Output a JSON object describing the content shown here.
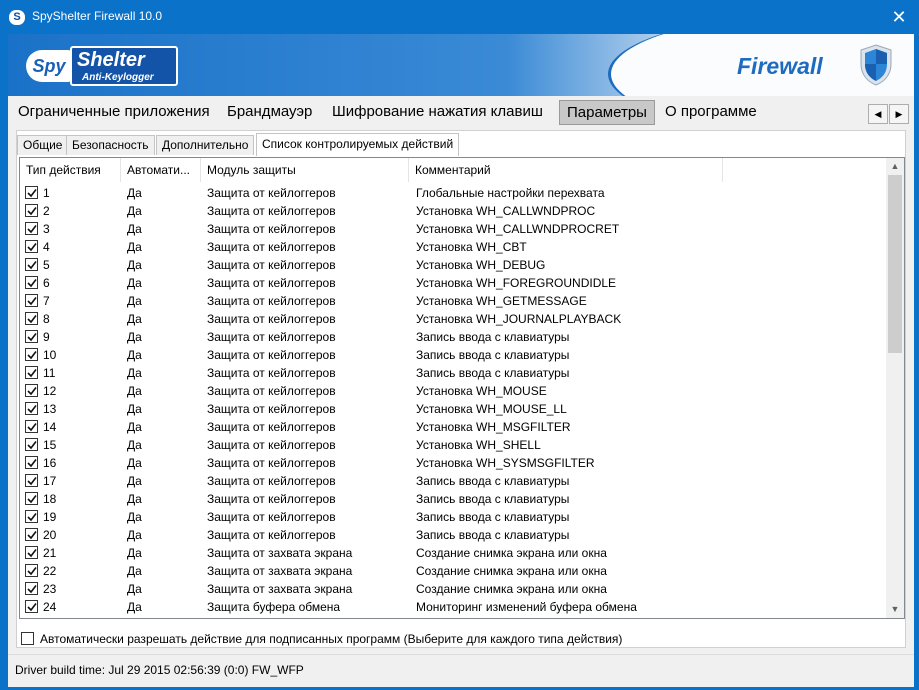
{
  "window": {
    "title": "SpyShelter Firewall 10.0",
    "close_glyph": "✕",
    "app_icon_letter": "S"
  },
  "banner": {
    "logo_spy": "Spy",
    "logo_shelter": "Shelter",
    "logo_sub": "Anti-Keylogger",
    "product": "Firewall"
  },
  "menu": {
    "items": [
      {
        "label": "Ограниченные приложения"
      },
      {
        "label": "Брандмауэр"
      },
      {
        "label": "Шифрование нажатия клавиш"
      },
      {
        "label": "Параметры",
        "active": true
      },
      {
        "label": "О программе"
      }
    ],
    "prev_glyph": "◀",
    "next_glyph": "▶"
  },
  "tabs": [
    {
      "label": "Общие"
    },
    {
      "label": "Безопасность"
    },
    {
      "label": "Дополнительно"
    },
    {
      "label": "Список контролируемых действий",
      "active": true
    }
  ],
  "table": {
    "columns": [
      "Тип действия",
      "Автомати...",
      "Модуль защиты",
      "Комментарий"
    ],
    "rows": [
      {
        "checked": true,
        "type": "1",
        "auto": "Да",
        "module": "Защита от кейлоггеров",
        "comment": "Глобальные настройки перехвата"
      },
      {
        "checked": true,
        "type": "2",
        "auto": "Да",
        "module": "Защита от кейлоггеров",
        "comment": "Установка WH_CALLWNDPROC"
      },
      {
        "checked": true,
        "type": "3",
        "auto": "Да",
        "module": "Защита от кейлоггеров",
        "comment": "Установка WH_CALLWNDPROCRET"
      },
      {
        "checked": true,
        "type": "4",
        "auto": "Да",
        "module": "Защита от кейлоггеров",
        "comment": "Установка WH_CBT"
      },
      {
        "checked": true,
        "type": "5",
        "auto": "Да",
        "module": "Защита от кейлоггеров",
        "comment": "Установка WH_DEBUG"
      },
      {
        "checked": true,
        "type": "6",
        "auto": "Да",
        "module": "Защита от кейлоггеров",
        "comment": "Установка WH_FOREGROUNDIDLE"
      },
      {
        "checked": true,
        "type": "7",
        "auto": "Да",
        "module": "Защита от кейлоггеров",
        "comment": "Установка WH_GETMESSAGE"
      },
      {
        "checked": true,
        "type": "8",
        "auto": "Да",
        "module": "Защита от кейлоггеров",
        "comment": "Установка WH_JOURNALPLAYBACK"
      },
      {
        "checked": true,
        "type": "9",
        "auto": "Да",
        "module": "Защита от кейлоггеров",
        "comment": "Запись ввода с клавиатуры"
      },
      {
        "checked": true,
        "type": "10",
        "auto": "Да",
        "module": "Защита от кейлоггеров",
        "comment": "Запись ввода с клавиатуры"
      },
      {
        "checked": true,
        "type": "11",
        "auto": "Да",
        "module": "Защита от кейлоггеров",
        "comment": "Запись ввода с клавиатуры"
      },
      {
        "checked": true,
        "type": "12",
        "auto": "Да",
        "module": "Защита от кейлоггеров",
        "comment": "Установка WH_MOUSE"
      },
      {
        "checked": true,
        "type": "13",
        "auto": "Да",
        "module": "Защита от кейлоггеров",
        "comment": "Установка WH_MOUSE_LL"
      },
      {
        "checked": true,
        "type": "14",
        "auto": "Да",
        "module": "Защита от кейлоггеров",
        "comment": "Установка WH_MSGFILTER"
      },
      {
        "checked": true,
        "type": "15",
        "auto": "Да",
        "module": "Защита от кейлоггеров",
        "comment": "Установка WH_SHELL"
      },
      {
        "checked": true,
        "type": "16",
        "auto": "Да",
        "module": "Защита от кейлоггеров",
        "comment": "Установка WH_SYSMSGFILTER"
      },
      {
        "checked": true,
        "type": "17",
        "auto": "Да",
        "module": "Защита от кейлоггеров",
        "comment": "Запись ввода с клавиатуры"
      },
      {
        "checked": true,
        "type": "18",
        "auto": "Да",
        "module": "Защита от кейлоггеров",
        "comment": "Запись ввода с клавиатуры"
      },
      {
        "checked": true,
        "type": "19",
        "auto": "Да",
        "module": "Защита от кейлоггеров",
        "comment": "Запись ввода с клавиатуры"
      },
      {
        "checked": true,
        "type": "20",
        "auto": "Да",
        "module": "Защита от кейлоггеров",
        "comment": "Запись ввода с клавиатуры"
      },
      {
        "checked": true,
        "type": "21",
        "auto": "Да",
        "module": "Защита от захвата экрана",
        "comment": "Создание снимка экрана или окна"
      },
      {
        "checked": true,
        "type": "22",
        "auto": "Да",
        "module": "Защита от захвата экрана",
        "comment": "Создание снимка экрана или окна"
      },
      {
        "checked": true,
        "type": "23",
        "auto": "Да",
        "module": "Защита от захвата экрана",
        "comment": "Создание снимка экрана или окна"
      },
      {
        "checked": true,
        "type": "24",
        "auto": "Да",
        "module": "Защита буфера обмена",
        "comment": "Мониторинг изменений буфера обмена"
      }
    ]
  },
  "scroll": {
    "up_glyph": "▲",
    "down_glyph": "▼"
  },
  "options": {
    "auto_allow_signed_label": "Автоматически разрешать действие для подписанных программ (Выберите для каждого типа действия)",
    "auto_allow_signed_checked": false
  },
  "status": {
    "text": "Driver build time: Jul 29 2015 02:56:39  (0:0) FW_WFP"
  }
}
